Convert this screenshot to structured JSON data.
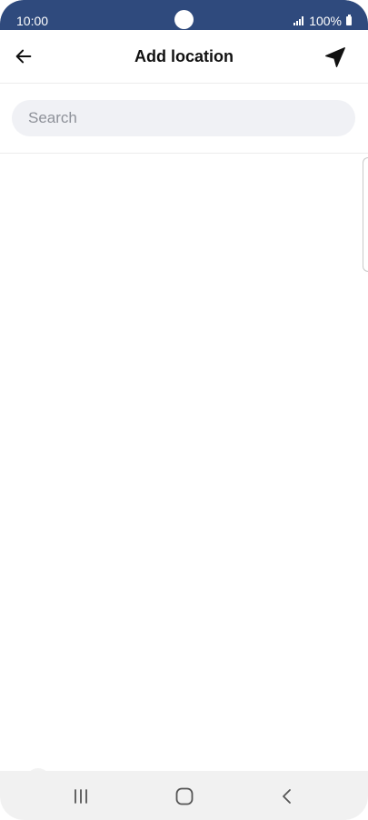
{
  "status_bar": {
    "time": "10:00",
    "battery": "100%"
  },
  "app_bar": {
    "title": "Add location",
    "back_icon": "arrow-left-icon",
    "locate_icon": "navigation-arrow-icon"
  },
  "search": {
    "placeholder": "Search",
    "value": ""
  },
  "results": {
    "items": []
  },
  "nav_bar": {
    "recents_icon": "recents-icon",
    "home_icon": "home-icon",
    "back_icon": "back-chevron-icon"
  },
  "colors": {
    "status_bar_bg": "#2f4a7d",
    "search_bg": "#f0f1f5",
    "placeholder": "#8e9199",
    "nav_bar_bg": "#f1f1f1"
  }
}
